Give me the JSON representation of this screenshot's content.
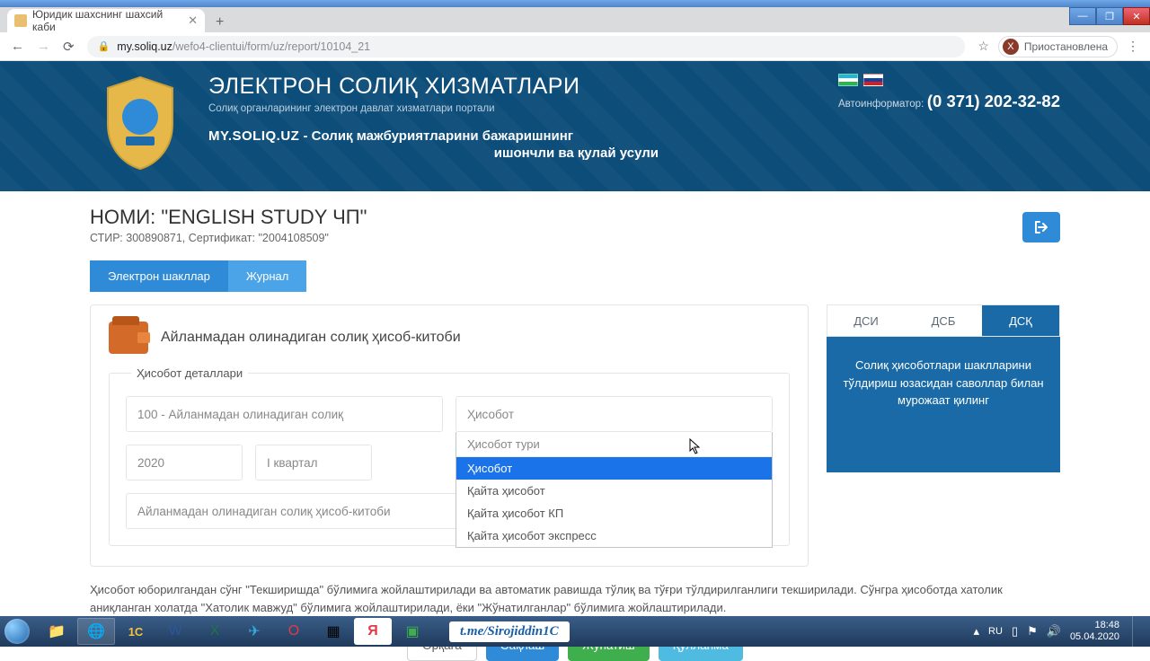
{
  "window": {
    "tab_title": "Юридик шахснинг шахсий каби",
    "url_host": "my.soliq.uz",
    "url_path": "/wefo4-clientui/form/uz/report/10104_21",
    "paused_label": "Приостановлена",
    "avatar_letter": "Х"
  },
  "header": {
    "title": "ЭЛЕКТРОН СОЛИҚ ХИЗМАТЛАРИ",
    "subtitle": "Солиқ органларининг электрон давлат хизматлари портали",
    "domain": "MY.SOLIQ.UZ",
    "tagline1": " - Солиқ мажбуриятларини бажаришнинг",
    "tagline2": "ишончли ва қулай усули",
    "autoinform_label": "Автоинформатор:",
    "phone": "(0 371) 202-32-82"
  },
  "page": {
    "name_label": "НОМИ: \"ENGLISH STUDY ЧП\"",
    "meta": "СТИР: 300890871, Сертификат: \"2004108509\""
  },
  "tabs": {
    "eforms": "Электрон шакллар",
    "journal": "Журнал"
  },
  "form": {
    "title": "Айланмадан олинадиган солиқ ҳисоб-китоби",
    "legend": "Ҳисобот деталлари",
    "tax_type": "100 - Айланмадан олинадиган солиқ",
    "report_select": "Ҳисобот",
    "year": "2020",
    "quarter": "I квартал",
    "doc_name": "Айланмадан олинадиган солиқ ҳисоб-китоби",
    "dropdown": {
      "head": "Ҳисобот тури",
      "options": [
        "Ҳисобот",
        "Қайта ҳисобот",
        "Қайта ҳисобот КП",
        "Қайта ҳисобот экспресс"
      ],
      "selected_index": 0,
      "cursor_text": "Ҳисоб"
    }
  },
  "side": {
    "tabs": [
      "ДСИ",
      "ДСБ",
      "ДСҚ"
    ],
    "active_index": 2,
    "text": "Солиқ ҳисоботлари шаклларини тўлдириш юзасидан саволлар билан мурожаат қилинг"
  },
  "note": "Ҳисобот юборилгандан сўнг \"Текширишда\" бўлимига жойлаштирилади ва автоматик равишда тўлиқ ва тўғри тўлдирилганлиги текширилади. Сўнгра ҳисоботда хатолик аниқланган холатда \"Хатолик мавжуд\" бўлимига жойлаштирилади, ёки \"Жўнатилганлар\" бўлимига жойлаштирилади.",
  "buttons": {
    "back": "Орқага",
    "save": "Сақлаш",
    "send": "Жўнатиш",
    "guide": "Қўлланма"
  },
  "taskbar": {
    "telegram": "t.me/Sirojiddin1C",
    "lang": "RU",
    "time": "18:48",
    "date": "05.04.2020"
  }
}
